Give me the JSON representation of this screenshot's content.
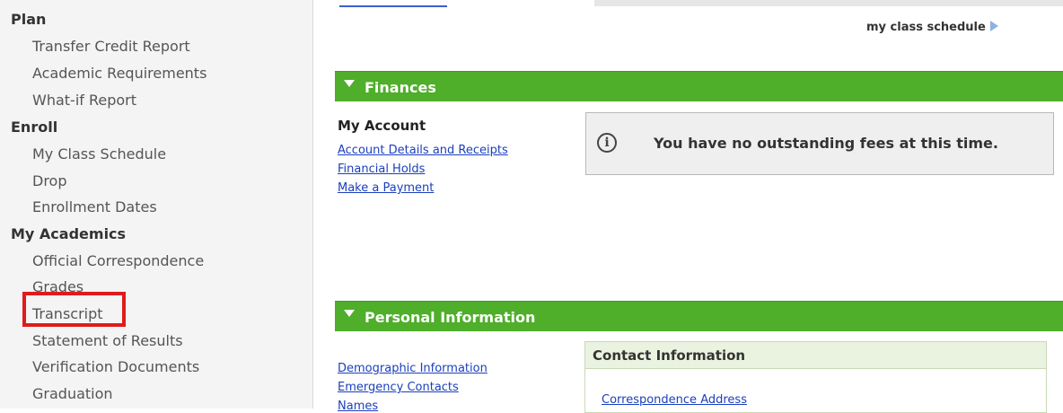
{
  "sidebar": {
    "plan": {
      "heading": "Plan",
      "items": [
        "Transfer Credit Report",
        "Academic Requirements",
        "What-if Report"
      ]
    },
    "enroll": {
      "heading": "Enroll",
      "items": [
        "My Class Schedule",
        "Drop",
        "Enrollment Dates"
      ]
    },
    "academics": {
      "heading": "My Academics",
      "items": [
        "Official Correspondence",
        "Grades",
        "Transcript",
        "Statement of Results",
        "Verification Documents",
        "Graduation"
      ]
    }
  },
  "main": {
    "schedule_link": "my class schedule",
    "finances": {
      "title": "Finances",
      "account_heading": "My Account",
      "links": [
        "Account Details and Receipts",
        "Financial Holds",
        "Make a Payment"
      ],
      "notice": "You have no outstanding fees at this time."
    },
    "personal": {
      "title": "Personal Information",
      "links": [
        "Demographic Information",
        "Emergency Contacts",
        "Names"
      ],
      "contact": {
        "title": "Contact Information",
        "links": [
          "Correspondence Address"
        ]
      }
    }
  },
  "colors": {
    "section_green": "#4fae2a",
    "link_blue": "#1a3fbd",
    "highlight_red": "#e01b1b"
  },
  "icons": {
    "section_toggle": "triangle-down-icon",
    "schedule_arrow": "play-arrow-icon",
    "notice": "info-icon"
  }
}
